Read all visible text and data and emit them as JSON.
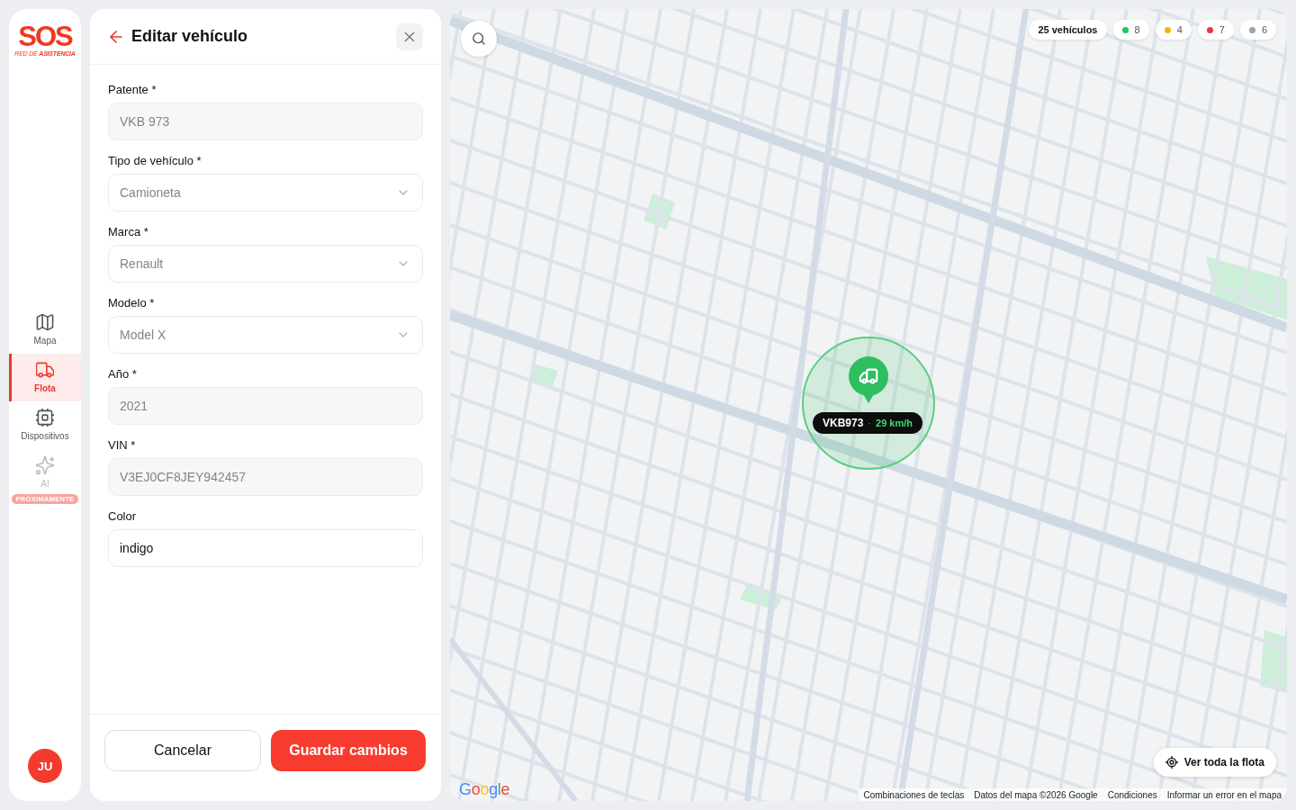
{
  "sidebar": {
    "logo": {
      "title": "SOS",
      "subtitle": "RED DE **ASISTENCIA**"
    },
    "nav": [
      {
        "label": "Mapa",
        "selected": false,
        "disabled": false
      },
      {
        "label": "Flota",
        "selected": true,
        "disabled": false
      },
      {
        "label": "Dispositivos",
        "selected": false,
        "disabled": false
      },
      {
        "label": "AI",
        "selected": false,
        "disabled": true,
        "badge": "PRÓXIMAMENTE"
      }
    ],
    "avatar": "JU"
  },
  "panel": {
    "title": "Editar vehículo",
    "fields": [
      {
        "label": "Patente *",
        "kind": "text",
        "value": "VKB 973",
        "disabled": true
      },
      {
        "label": "Tipo de vehículo *",
        "kind": "select",
        "value": "Camioneta",
        "disabled": true
      },
      {
        "label": "Marca *",
        "kind": "select",
        "value": "Renault",
        "disabled": true
      },
      {
        "label": "Modelo *",
        "kind": "select",
        "value": "Model X",
        "disabled": true
      },
      {
        "label": "Año *",
        "kind": "text",
        "value": "2021",
        "disabled": true
      },
      {
        "label": "VIN *",
        "kind": "text",
        "value": "V3EJ0CF8JEY942457",
        "disabled": true
      },
      {
        "label": "Color",
        "kind": "text",
        "value": "indigo",
        "disabled": false
      }
    ],
    "buttons": [
      {
        "label": "Cancelar",
        "kind": "secondary"
      },
      {
        "label": "Guardar cambios",
        "kind": "primary"
      }
    ]
  },
  "map": {
    "total": "25 vehículos",
    "status_chips": [
      {
        "count": "8",
        "color": "#22c55e"
      },
      {
        "count": "4",
        "color": "#f5b400"
      },
      {
        "count": "7",
        "color": "#ef3340"
      },
      {
        "count": "6",
        "color": "#9ca3af"
      }
    ],
    "vehicle": {
      "plate": "VKB973",
      "separator": "·",
      "speed": "29 km/h"
    },
    "fleet_button": "Ver toda la flota",
    "logo": "Google",
    "attribution": [
      "Combinaciones de teclas",
      "Datos del mapa ©2026 Google",
      "Condiciones",
      "Informar un error en el mapa"
    ]
  }
}
